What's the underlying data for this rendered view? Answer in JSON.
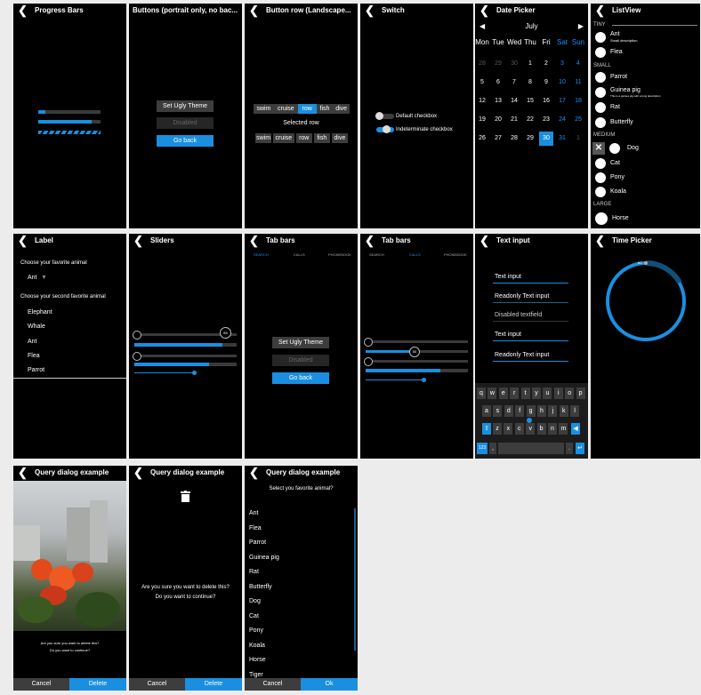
{
  "screens": {
    "progress": {
      "title": "Progress Bars"
    },
    "buttons": {
      "title": "Buttons (portrait only, no bac...",
      "set_theme": "Set Ugly Theme",
      "disabled": "Disabled",
      "go_back": "Go back"
    },
    "button_row": {
      "title": "Button row (Landscape...",
      "row1": [
        "swim",
        "cruise",
        "row",
        "fish",
        "dive"
      ],
      "selected_label": "Selected row",
      "row2": [
        "swim",
        "cruise",
        "row",
        "fish",
        "dive"
      ]
    },
    "switch": {
      "title": "Switch",
      "default_checkbox": "Default checkbox",
      "indeterminate_checkbox": "Indeterminate checkbox"
    },
    "date_picker": {
      "title": "Date Picker",
      "month": "July",
      "weekdays": [
        "Mon",
        "Tue",
        "Wed",
        "Thu",
        "Fri",
        "Sat",
        "Sun"
      ],
      "weeks": [
        [
          "28",
          "29",
          "30",
          "1",
          "2",
          "3",
          "4"
        ],
        [
          "5",
          "6",
          "7",
          "8",
          "9",
          "10",
          "11"
        ],
        [
          "12",
          "13",
          "14",
          "15",
          "16",
          "17",
          "18"
        ],
        [
          "19",
          "20",
          "21",
          "22",
          "23",
          "24",
          "25"
        ],
        [
          "26",
          "27",
          "28",
          "29",
          "30",
          "31",
          "1"
        ]
      ],
      "selected": "30"
    },
    "listview": {
      "title": "ListView",
      "tiny_header": "TINY",
      "ant": "Ant",
      "ant_sub": "Small description",
      "flea": "Flea",
      "small_header": "SMALL",
      "parrot": "Parrot",
      "guinea_pig": "Guinea pig",
      "guinea_sub": "This is a guinea pig with a long description",
      "rat": "Rat",
      "butterfly": "Butterfly",
      "medium_header": "MEDIUM",
      "dog": "Dog",
      "cat": "Cat",
      "pony": "Pony",
      "koala": "Koala",
      "large_header": "LARGE",
      "horse": "Horse"
    },
    "label": {
      "title": "Label",
      "q1": "Choose your favorite animal",
      "selected": "Ant",
      "q2": "Choose your second favorite animal",
      "items": [
        "Elephant",
        "Whale",
        "Ant",
        "Flea",
        "Parrot"
      ]
    },
    "sliders": {
      "title": "Sliders",
      "slider1_value": "85",
      "slider1_fraction": 0.85,
      "bar1_fraction": 0.86,
      "bar2_fraction": 0.73,
      "thin_fraction": 0.58
    },
    "tab_bars1": {
      "title": "Tab bars",
      "tabs": [
        "SEARCH",
        "CALLS",
        "PHONEBOOK"
      ],
      "set_theme": "Set Ugly Theme",
      "disabled": "Disabled",
      "go_back": "Go back"
    },
    "tab_bars2": {
      "title": "Tab bars",
      "tabs": [
        "SEARCH",
        "CALLS",
        "PHONEBOOK"
      ],
      "slider_value": "50",
      "slider_fraction": 0.48,
      "bar_fraction": 0.73,
      "thin_fraction": 0.58
    },
    "text_input": {
      "title": "Text input",
      "fields": [
        "Text input",
        "Readonly Text input",
        "Disabled textfield",
        "Text input",
        "Readonly Text input"
      ],
      "kb_row1": [
        "q",
        "w",
        "e",
        "r",
        "t",
        "y",
        "u",
        "i",
        "o",
        "p"
      ],
      "kb_row2": [
        "a",
        "s",
        "d",
        "f",
        "g",
        "h",
        "j",
        "k",
        "l"
      ],
      "kb_row3": [
        "z",
        "x",
        "c",
        "v",
        "b",
        "n",
        "m"
      ],
      "kb_num": "123",
      "kb_comma": ",",
      "kb_period": "."
    },
    "time_picker": {
      "title": "Time Picker",
      "tick_label": "60"
    },
    "dialog1": {
      "title": "Query dialog example",
      "line1": "Are you sure you want to delete this?",
      "line2": "Do you want to continue?",
      "cancel": "Cancel",
      "delete": "Delete"
    },
    "dialog2": {
      "title": "Query dialog example",
      "line1": "Are you sure you want to delete this?",
      "line2": "Do you want to continue?",
      "cancel": "Cancel",
      "delete": "Delete"
    },
    "dialog3": {
      "title": "Query dialog example",
      "subtitle": "Select you favorite animal?",
      "items": [
        "Ant",
        "Flea",
        "Parrot",
        "Guinea pig",
        "Rat",
        "Butterfly",
        "Dog",
        "Cat",
        "Pony",
        "Koala",
        "Horse",
        "Tiger"
      ],
      "cancel": "Cancel",
      "ok": "Ok"
    }
  },
  "colors": {
    "accent": "#1a8fe0",
    "background": "#000000",
    "page": "#ececec"
  },
  "icons": {
    "back": "chevron-left-icon",
    "trash": "trash-icon"
  }
}
